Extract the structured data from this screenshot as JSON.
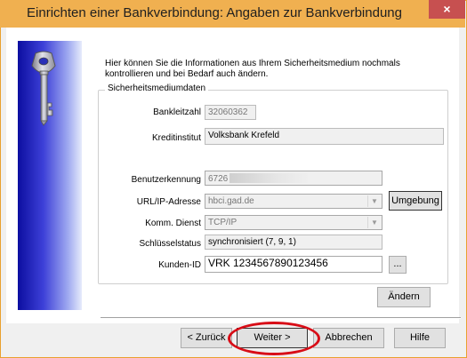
{
  "window": {
    "title": "Einrichten einer Bankverbindung: Angaben zur Bankverbindung",
    "close_glyph": "×"
  },
  "intro_text": "Hier können Sie die Informationen aus Ihrem Sicherheitsmedium nochmals kontrollieren und bei Bedarf auch ändern.",
  "group": {
    "legend": "Sicherheitsmediumdaten",
    "fields": {
      "bankleitzahl": {
        "label": "Bankleitzahl",
        "value": "32060362"
      },
      "kreditinstitut": {
        "label": "Kreditinstitut",
        "value": "Volksbank Krefeld"
      },
      "benutzerkennung": {
        "label": "Benutzerkennung",
        "value": "6726"
      },
      "url": {
        "label": "URL/IP-Adresse",
        "value": "hbci.gad.de"
      },
      "komm_dienst": {
        "label": "Komm. Dienst",
        "value": "TCP/IP"
      },
      "schluesselstatus": {
        "label": "Schlüsselstatus",
        "value": "synchronisiert (7, 9, 1)"
      },
      "kunden_id": {
        "label": "Kunden-ID",
        "value": "VRK 1234567890123456"
      }
    },
    "umgebung_button": {
      "label": "Umgebung"
    },
    "ellipsis_button": {
      "label": "..."
    },
    "aendern_button": {
      "label": "Ändern"
    }
  },
  "footer": {
    "back_button": "< Zurück",
    "next_button": "Weiter >",
    "cancel_button": "Abbrechen",
    "help_button": "Hilfe"
  },
  "icons": {
    "key": "key-icon",
    "close": "close-icon",
    "dropdown": "chevron-down-icon"
  },
  "colors": {
    "titlebar": "#f0b050",
    "close_button": "#c75050",
    "sidepanel_dark": "#0c0ea0",
    "sidepanel_light": "#e6ebfb",
    "annotation": "#d80d17"
  }
}
